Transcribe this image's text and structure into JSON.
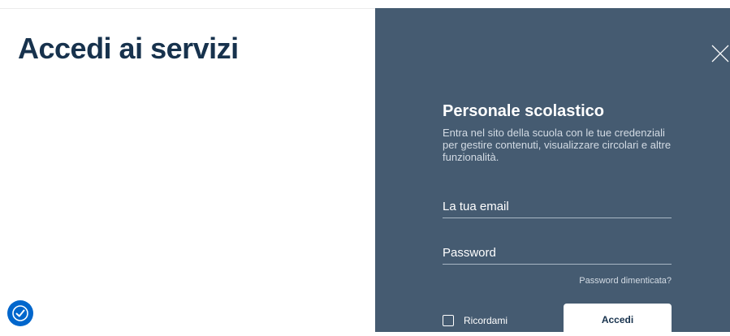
{
  "page": {
    "title": "Accedi ai servizi"
  },
  "icons": {
    "close": "close-icon",
    "accessibility": "accessibility-icon"
  },
  "panel": {
    "bg_color": "#455b71",
    "title": "Personale scolastico",
    "description": "Entra nel sito della scuola con le tue credenziali per gestire contenuti, visualizzare circolari e altre funzionalità.",
    "email_placeholder": "La tua email",
    "password_placeholder": "Password",
    "forgot_password": "Password dimenticata?",
    "remember_label": "Ricordami",
    "remember_checked": false,
    "submit_label": "Accedi"
  }
}
